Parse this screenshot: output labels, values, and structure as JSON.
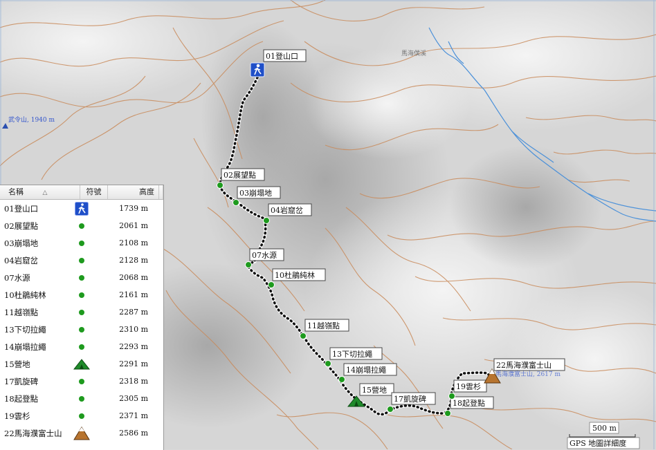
{
  "map": {
    "waypoints": [
      {
        "label": "01登山口"
      },
      {
        "label": "02展望點"
      },
      {
        "label": "03崩塌地"
      },
      {
        "label": "04岩窟岔"
      },
      {
        "label": "07水源"
      },
      {
        "label": "10杜鵑純林"
      },
      {
        "label": "11越嶺點"
      },
      {
        "label": "13下切拉繩"
      },
      {
        "label": "14崩塌拉繩"
      },
      {
        "label": "15營地"
      },
      {
        "label": "17凱旋碑"
      },
      {
        "label": "18起登點"
      },
      {
        "label": "19雲杉"
      },
      {
        "label": "22馬海濮富士山"
      }
    ],
    "peak_west": "武令山, 1940 m",
    "stream_label": "馬海僕溪",
    "peak_east_faded": "馬海濮富士山, 2617 m",
    "scale_label": "500 m",
    "detail_label": "GPS 地圖詳細度"
  },
  "table": {
    "col_name": "名稱",
    "col_symbol": "符號",
    "col_elevation": "高度",
    "sort_indicator": "△",
    "rows": [
      {
        "name": "01登山口",
        "symbol": "hiker-icon",
        "elevation": "1739 m"
      },
      {
        "name": "02展望點",
        "symbol": "green-dot",
        "elevation": "2061 m"
      },
      {
        "name": "03崩塌地",
        "symbol": "green-dot",
        "elevation": "2108 m"
      },
      {
        "name": "04岩窟岔",
        "symbol": "green-dot",
        "elevation": "2128 m"
      },
      {
        "name": "07水源",
        "symbol": "green-dot",
        "elevation": "2068 m"
      },
      {
        "name": "10杜鵑純林",
        "symbol": "green-dot",
        "elevation": "2161 m"
      },
      {
        "name": "11越嶺點",
        "symbol": "green-dot",
        "elevation": "2287 m"
      },
      {
        "name": "13下切拉繩",
        "symbol": "green-dot",
        "elevation": "2310 m"
      },
      {
        "name": "14崩塌拉繩",
        "symbol": "green-dot",
        "elevation": "2293 m"
      },
      {
        "name": "15營地",
        "symbol": "tent-icon",
        "elevation": "2291 m"
      },
      {
        "name": "17凱旋碑",
        "symbol": "green-dot",
        "elevation": "2318 m"
      },
      {
        "name": "18起登點",
        "symbol": "green-dot",
        "elevation": "2305 m"
      },
      {
        "name": "19雲杉",
        "symbol": "green-dot",
        "elevation": "2371 m"
      },
      {
        "name": "22馬海濮富士山",
        "symbol": "summit-icon",
        "elevation": "2586 m"
      }
    ]
  },
  "colors": {
    "contour": "#c98a5a",
    "track": "#111111",
    "waypoint": "#1e9a1e",
    "stream": "#4a90d9"
  }
}
